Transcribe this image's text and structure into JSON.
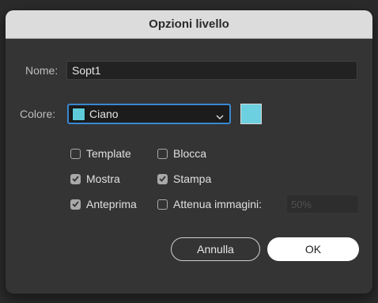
{
  "dialog": {
    "title": "Opzioni livello"
  },
  "name": {
    "label": "Nome:",
    "value": "Sopt1"
  },
  "color": {
    "label": "Colore:",
    "value": "Ciano",
    "swatch": "#6cd0e0",
    "icon": "chevron-down-icon"
  },
  "options": {
    "template": {
      "label": "Template",
      "checked": false
    },
    "lock": {
      "label": "Blocca",
      "checked": false
    },
    "show": {
      "label": "Mostra",
      "checked": true
    },
    "print": {
      "label": "Stampa",
      "checked": true
    },
    "preview": {
      "label": "Anteprima",
      "checked": true
    },
    "dim": {
      "label": "Attenua immagini:",
      "checked": false,
      "value": "50%"
    }
  },
  "buttons": {
    "cancel": "Annulla",
    "ok": "OK"
  }
}
